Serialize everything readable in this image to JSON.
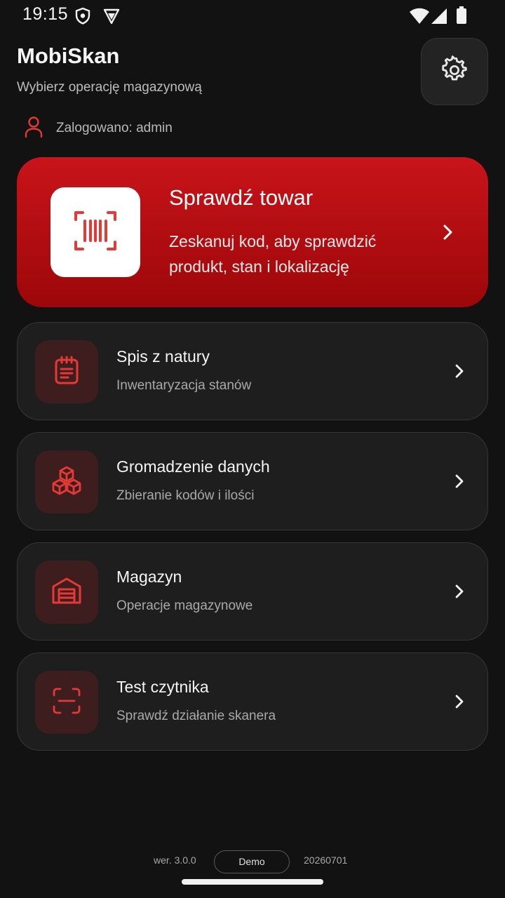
{
  "status_bar": {
    "time": "19:15",
    "icons": [
      "shield-icon",
      "vpn-icon",
      "wifi-icon",
      "signal-icon",
      "battery-icon"
    ]
  },
  "header": {
    "title": "MobiSkan",
    "subtitle": "Wybierz operację magazynową",
    "user_label": "Zalogowano: admin"
  },
  "hero": {
    "title": "Sprawdź towar",
    "description": "Zeskanuj kod, aby sprawdzić produkt, stan i lokalizację",
    "icon": "barcode-scan-icon"
  },
  "menu": [
    {
      "title": "Spis z natury",
      "subtitle": "Inwentaryzacja stanów",
      "icon": "clipboard-icon"
    },
    {
      "title": "Gromadzenie danych",
      "subtitle": "Zbieranie kodów i ilości",
      "icon": "boxes-icon"
    },
    {
      "title": "Magazyn",
      "subtitle": "Operacje magazynowe",
      "icon": "warehouse-icon"
    },
    {
      "title": "Test czytnika",
      "subtitle": "Sprawdź działanie skanera",
      "icon": "scan-frame-icon"
    }
  ],
  "footer": {
    "version": "wer. 3.0.0",
    "mode": "Demo",
    "build": "20260701"
  },
  "colors": {
    "background": "#121212",
    "accent": "#c8141a",
    "card": "#1e1e1e",
    "icon_tile": "#3e1d1e",
    "icon_red": "#e53935"
  }
}
